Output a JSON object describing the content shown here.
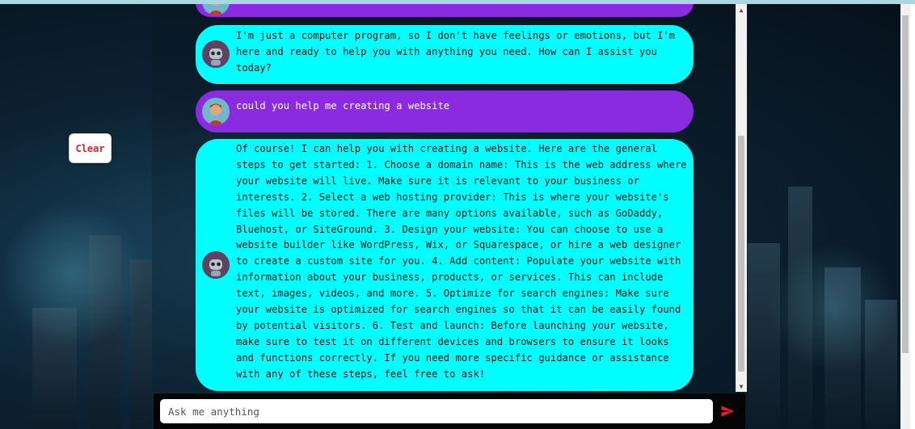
{
  "clear_button": {
    "label": "Clear"
  },
  "messages": [
    {
      "role": "user",
      "text": ""
    },
    {
      "role": "bot",
      "text": "I'm just a computer program, so I don't have feelings or emotions, but I'm here and ready to help you with anything you need. How can I assist you today?"
    },
    {
      "role": "user",
      "text": "could you help me creating a website"
    },
    {
      "role": "bot",
      "text": "Of course! I can help you with creating a website. Here are the general steps to get started: 1. Choose a domain name: This is the web address where your website will live. Make sure it is relevant to your business or interests. 2. Select a web hosting provider: This is where your website's files will be stored. There are many options available, such as GoDaddy, Bluehost, or SiteGround. 3. Design your website: You can choose to use a website builder like WordPress, Wix, or Squarespace, or hire a web designer to create a custom site for you. 4. Add content: Populate your website with information about your business, products, or services. This can include text, images, videos, and more. 5. Optimize for search engines: Make sure your website is optimized for search engines so that it can be easily found by potential visitors. 6. Test and launch: Before launching your website, make sure to test it on different devices and browsers to ensure it looks and functions correctly. If you need more specific guidance or assistance with any of these steps, feel free to ask!"
    }
  ],
  "input": {
    "placeholder": "Ask me anything",
    "value": ""
  },
  "icons": {
    "send": "send-icon",
    "bot_avatar": "robot-icon",
    "user_avatar": "user-icon"
  },
  "colors": {
    "bot_bubble": "#00ffff",
    "user_bubble": "#8a2be2",
    "clear_text": "#d0262d",
    "send_icon": "#e0202a"
  }
}
